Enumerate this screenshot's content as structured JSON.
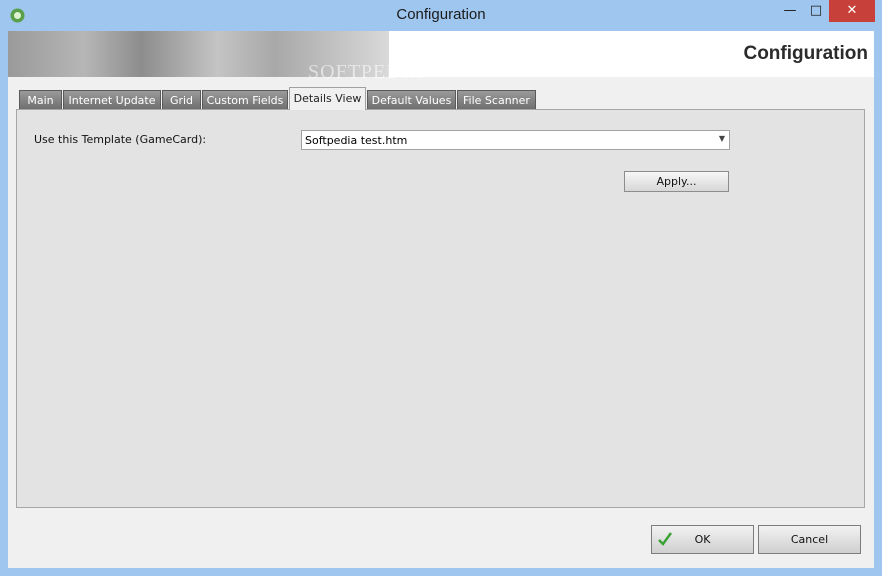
{
  "window": {
    "title": "Configuration",
    "minimize_glyph": "—",
    "maximize_glyph": "□",
    "close_glyph": "✕"
  },
  "banner": {
    "heading": "Configuration",
    "watermark": "SOFTPEDIA"
  },
  "tabs": [
    {
      "label": "Main",
      "active": false
    },
    {
      "label": "Internet Update",
      "active": false
    },
    {
      "label": "Grid",
      "active": false
    },
    {
      "label": "Custom Fields",
      "active": false
    },
    {
      "label": "Details View",
      "active": true
    },
    {
      "label": "Default Values",
      "active": false
    },
    {
      "label": "File Scanner",
      "active": false
    }
  ],
  "details_view": {
    "template_label": "Use this Template (GameCard):",
    "template_value": "Softpedia test.htm",
    "apply_label": "Apply..."
  },
  "footer": {
    "ok_label": "OK",
    "cancel_label": "Cancel"
  },
  "colors": {
    "title_bar": "#9fc6ee",
    "close_button": "#c7413a",
    "inactive_tab": "#7a7a7a",
    "ok_check": "#3aa335"
  },
  "icons": {
    "app": "app-icon",
    "ok": "check-icon",
    "dropdown": "chevron-down-icon"
  }
}
